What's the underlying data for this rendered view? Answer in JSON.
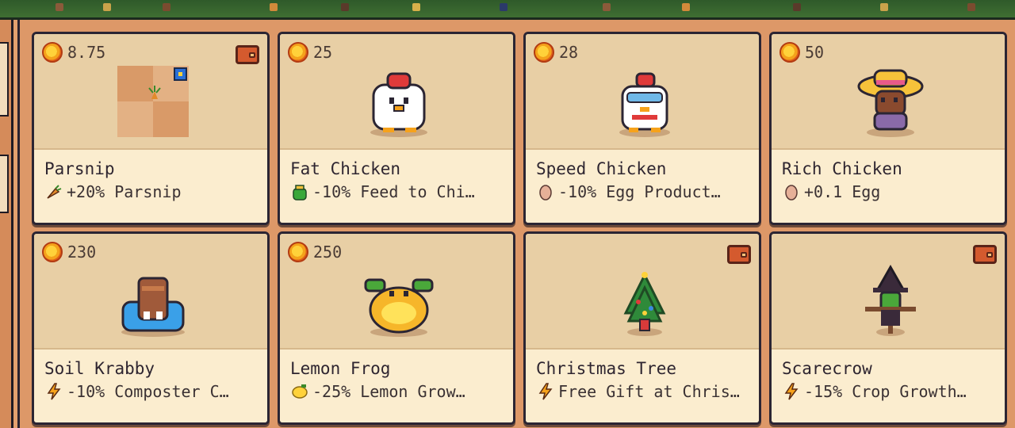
{
  "colors": {
    "card_top": "#e8cfa5",
    "card_bottom": "#fbedcf",
    "background": "#e3a06e",
    "border": "#2b2533",
    "text": "#2e2530"
  },
  "items": [
    {
      "price": "8.75",
      "wallet": true,
      "name": "Parsnip",
      "effect_icon": "parsnip-icon",
      "effect": "+20% Parsnip",
      "art": "parsnip-plot"
    },
    {
      "price": "25",
      "wallet": false,
      "name": "Fat Chicken",
      "effect_icon": "feed-bag-icon",
      "effect": "-10% Feed to Chi…",
      "art": "fat-chicken"
    },
    {
      "price": "28",
      "wallet": false,
      "name": "Speed Chicken",
      "effect_icon": "egg-icon",
      "effect": "-10% Egg Product…",
      "art": "speed-chicken"
    },
    {
      "price": "50",
      "wallet": false,
      "name": "Rich Chicken",
      "effect_icon": "egg-icon",
      "effect": "+0.1 Egg",
      "art": "rich-chicken"
    },
    {
      "price": "230",
      "wallet": false,
      "name": "Soil Krabby",
      "effect_icon": "lightning-icon",
      "effect": "-10% Composter C…",
      "art": "soil-krabby"
    },
    {
      "price": "250",
      "wallet": false,
      "name": "Lemon Frog",
      "effect_icon": "lemon-icon",
      "effect": "-25% Lemon Grow…",
      "art": "lemon-frog"
    },
    {
      "price": "",
      "wallet": true,
      "name": "Christmas Tree",
      "effect_icon": "lightning-icon",
      "effect": "Free Gift at Chris…",
      "art": "christmas-tree"
    },
    {
      "price": "",
      "wallet": true,
      "name": "Scarecrow",
      "effect_icon": "lightning-icon",
      "effect": "-15% Crop Growth…",
      "art": "scarecrow"
    }
  ]
}
